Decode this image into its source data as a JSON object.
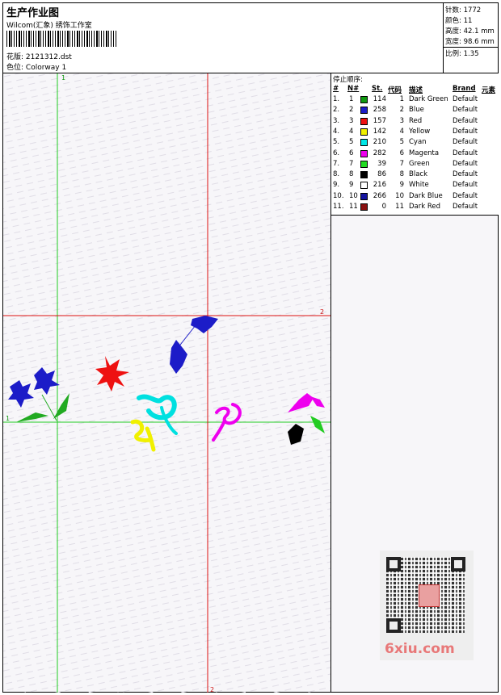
{
  "header": {
    "title": "生产作业图",
    "company": "Wilcom(汇象) 绣饰工作室",
    "pattern_label": "花版:",
    "pattern_value": "2121312.dst",
    "color_label": "色位:",
    "color_value": "Colorway 1"
  },
  "stats": [
    {
      "label": "针数:",
      "value": "1772"
    },
    {
      "label": "颜色:",
      "value": "11"
    },
    {
      "label": "高度:",
      "value": "42.1 mm"
    },
    {
      "label": "宽度:",
      "value": "98.6 mm"
    },
    {
      "label": "比例:",
      "value": "1.35"
    }
  ],
  "stop_sequence": {
    "title": "停止顺序:",
    "headers": [
      "#",
      "N#",
      "St.",
      "代码",
      "描述",
      "Brand",
      "元素"
    ],
    "rows": [
      {
        "idx": "1.",
        "n": "1",
        "st": "114",
        "code": "1",
        "desc": "Dark Green",
        "brand": "Default",
        "color": "#119a11"
      },
      {
        "idx": "2.",
        "n": "2",
        "st": "258",
        "code": "2",
        "desc": "Blue",
        "brand": "Default",
        "color": "#1c1cc8"
      },
      {
        "idx": "3.",
        "n": "3",
        "st": "157",
        "code": "3",
        "desc": "Red",
        "brand": "Default",
        "color": "#ee1111"
      },
      {
        "idx": "4.",
        "n": "4",
        "st": "142",
        "code": "4",
        "desc": "Yellow",
        "brand": "Default",
        "color": "#f0f000"
      },
      {
        "idx": "5.",
        "n": "5",
        "st": "210",
        "code": "5",
        "desc": "Cyan",
        "brand": "Default",
        "color": "#00e8e8"
      },
      {
        "idx": "6.",
        "n": "6",
        "st": "282",
        "code": "6",
        "desc": "Magenta",
        "brand": "Default",
        "color": "#ee00ee"
      },
      {
        "idx": "7.",
        "n": "7",
        "st": "39",
        "code": "7",
        "desc": "Green",
        "brand": "Default",
        "color": "#22dd22"
      },
      {
        "idx": "8.",
        "n": "8",
        "st": "86",
        "code": "8",
        "desc": "Black",
        "brand": "Default",
        "color": "#000000"
      },
      {
        "idx": "9.",
        "n": "9",
        "st": "216",
        "code": "9",
        "desc": "White",
        "brand": "Default",
        "color": "#ffffff"
      },
      {
        "idx": "10.",
        "n": "10",
        "st": "266",
        "code": "10",
        "desc": "Dark Blue",
        "brand": "Default",
        "color": "#1414a0"
      },
      {
        "idx": "11.",
        "n": "11",
        "st": "0",
        "code": "11",
        "desc": "Dark Red",
        "brand": "Default",
        "color": "#8a1010"
      }
    ]
  },
  "guides": {
    "v1_label": "1",
    "h1_label": "1",
    "h2_label": "2",
    "v2_label": "2"
  },
  "watermark": {
    "text": "6xiu.com"
  }
}
